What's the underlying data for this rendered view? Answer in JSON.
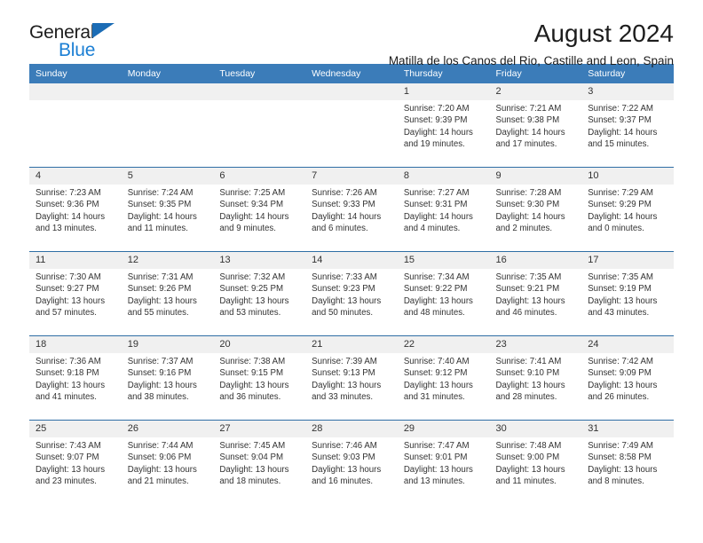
{
  "brand": {
    "name_part1": "General",
    "name_part2": "Blue",
    "triangle_icon": "triangle-icon",
    "color_dark": "#1d1d1d",
    "color_blue": "#1b7fd4"
  },
  "header": {
    "title": "August 2024",
    "subtitle": "Matilla de los Canos del Rio, Castille and Leon, Spain"
  },
  "theme": {
    "header_blue": "#3b7cb9",
    "rule_blue": "#2f6ea5",
    "daynum_band": "#f0f0f0",
    "text": "#333333"
  },
  "calendar": {
    "weekday_headers": [
      "Sunday",
      "Monday",
      "Tuesday",
      "Wednesday",
      "Thursday",
      "Friday",
      "Saturday"
    ],
    "weeks": [
      {
        "days": [
          {
            "num": "",
            "lines": [
              "",
              "",
              "",
              ""
            ]
          },
          {
            "num": "",
            "lines": [
              "",
              "",
              "",
              ""
            ]
          },
          {
            "num": "",
            "lines": [
              "",
              "",
              "",
              ""
            ]
          },
          {
            "num": "",
            "lines": [
              "",
              "",
              "",
              ""
            ]
          },
          {
            "num": "1",
            "lines": [
              "Sunrise: 7:20 AM",
              "Sunset: 9:39 PM",
              "Daylight: 14 hours",
              "and 19 minutes."
            ]
          },
          {
            "num": "2",
            "lines": [
              "Sunrise: 7:21 AM",
              "Sunset: 9:38 PM",
              "Daylight: 14 hours",
              "and 17 minutes."
            ]
          },
          {
            "num": "3",
            "lines": [
              "Sunrise: 7:22 AM",
              "Sunset: 9:37 PM",
              "Daylight: 14 hours",
              "and 15 minutes."
            ]
          }
        ]
      },
      {
        "days": [
          {
            "num": "4",
            "lines": [
              "Sunrise: 7:23 AM",
              "Sunset: 9:36 PM",
              "Daylight: 14 hours",
              "and 13 minutes."
            ]
          },
          {
            "num": "5",
            "lines": [
              "Sunrise: 7:24 AM",
              "Sunset: 9:35 PM",
              "Daylight: 14 hours",
              "and 11 minutes."
            ]
          },
          {
            "num": "6",
            "lines": [
              "Sunrise: 7:25 AM",
              "Sunset: 9:34 PM",
              "Daylight: 14 hours",
              "and 9 minutes."
            ]
          },
          {
            "num": "7",
            "lines": [
              "Sunrise: 7:26 AM",
              "Sunset: 9:33 PM",
              "Daylight: 14 hours",
              "and 6 minutes."
            ]
          },
          {
            "num": "8",
            "lines": [
              "Sunrise: 7:27 AM",
              "Sunset: 9:31 PM",
              "Daylight: 14 hours",
              "and 4 minutes."
            ]
          },
          {
            "num": "9",
            "lines": [
              "Sunrise: 7:28 AM",
              "Sunset: 9:30 PM",
              "Daylight: 14 hours",
              "and 2 minutes."
            ]
          },
          {
            "num": "10",
            "lines": [
              "Sunrise: 7:29 AM",
              "Sunset: 9:29 PM",
              "Daylight: 14 hours",
              "and 0 minutes."
            ]
          }
        ]
      },
      {
        "days": [
          {
            "num": "11",
            "lines": [
              "Sunrise: 7:30 AM",
              "Sunset: 9:27 PM",
              "Daylight: 13 hours",
              "and 57 minutes."
            ]
          },
          {
            "num": "12",
            "lines": [
              "Sunrise: 7:31 AM",
              "Sunset: 9:26 PM",
              "Daylight: 13 hours",
              "and 55 minutes."
            ]
          },
          {
            "num": "13",
            "lines": [
              "Sunrise: 7:32 AM",
              "Sunset: 9:25 PM",
              "Daylight: 13 hours",
              "and 53 minutes."
            ]
          },
          {
            "num": "14",
            "lines": [
              "Sunrise: 7:33 AM",
              "Sunset: 9:23 PM",
              "Daylight: 13 hours",
              "and 50 minutes."
            ]
          },
          {
            "num": "15",
            "lines": [
              "Sunrise: 7:34 AM",
              "Sunset: 9:22 PM",
              "Daylight: 13 hours",
              "and 48 minutes."
            ]
          },
          {
            "num": "16",
            "lines": [
              "Sunrise: 7:35 AM",
              "Sunset: 9:21 PM",
              "Daylight: 13 hours",
              "and 46 minutes."
            ]
          },
          {
            "num": "17",
            "lines": [
              "Sunrise: 7:35 AM",
              "Sunset: 9:19 PM",
              "Daylight: 13 hours",
              "and 43 minutes."
            ]
          }
        ]
      },
      {
        "days": [
          {
            "num": "18",
            "lines": [
              "Sunrise: 7:36 AM",
              "Sunset: 9:18 PM",
              "Daylight: 13 hours",
              "and 41 minutes."
            ]
          },
          {
            "num": "19",
            "lines": [
              "Sunrise: 7:37 AM",
              "Sunset: 9:16 PM",
              "Daylight: 13 hours",
              "and 38 minutes."
            ]
          },
          {
            "num": "20",
            "lines": [
              "Sunrise: 7:38 AM",
              "Sunset: 9:15 PM",
              "Daylight: 13 hours",
              "and 36 minutes."
            ]
          },
          {
            "num": "21",
            "lines": [
              "Sunrise: 7:39 AM",
              "Sunset: 9:13 PM",
              "Daylight: 13 hours",
              "and 33 minutes."
            ]
          },
          {
            "num": "22",
            "lines": [
              "Sunrise: 7:40 AM",
              "Sunset: 9:12 PM",
              "Daylight: 13 hours",
              "and 31 minutes."
            ]
          },
          {
            "num": "23",
            "lines": [
              "Sunrise: 7:41 AM",
              "Sunset: 9:10 PM",
              "Daylight: 13 hours",
              "and 28 minutes."
            ]
          },
          {
            "num": "24",
            "lines": [
              "Sunrise: 7:42 AM",
              "Sunset: 9:09 PM",
              "Daylight: 13 hours",
              "and 26 minutes."
            ]
          }
        ]
      },
      {
        "days": [
          {
            "num": "25",
            "lines": [
              "Sunrise: 7:43 AM",
              "Sunset: 9:07 PM",
              "Daylight: 13 hours",
              "and 23 minutes."
            ]
          },
          {
            "num": "26",
            "lines": [
              "Sunrise: 7:44 AM",
              "Sunset: 9:06 PM",
              "Daylight: 13 hours",
              "and 21 minutes."
            ]
          },
          {
            "num": "27",
            "lines": [
              "Sunrise: 7:45 AM",
              "Sunset: 9:04 PM",
              "Daylight: 13 hours",
              "and 18 minutes."
            ]
          },
          {
            "num": "28",
            "lines": [
              "Sunrise: 7:46 AM",
              "Sunset: 9:03 PM",
              "Daylight: 13 hours",
              "and 16 minutes."
            ]
          },
          {
            "num": "29",
            "lines": [
              "Sunrise: 7:47 AM",
              "Sunset: 9:01 PM",
              "Daylight: 13 hours",
              "and 13 minutes."
            ]
          },
          {
            "num": "30",
            "lines": [
              "Sunrise: 7:48 AM",
              "Sunset: 9:00 PM",
              "Daylight: 13 hours",
              "and 11 minutes."
            ]
          },
          {
            "num": "31",
            "lines": [
              "Sunrise: 7:49 AM",
              "Sunset: 8:58 PM",
              "Daylight: 13 hours",
              "and 8 minutes."
            ]
          }
        ]
      }
    ]
  }
}
